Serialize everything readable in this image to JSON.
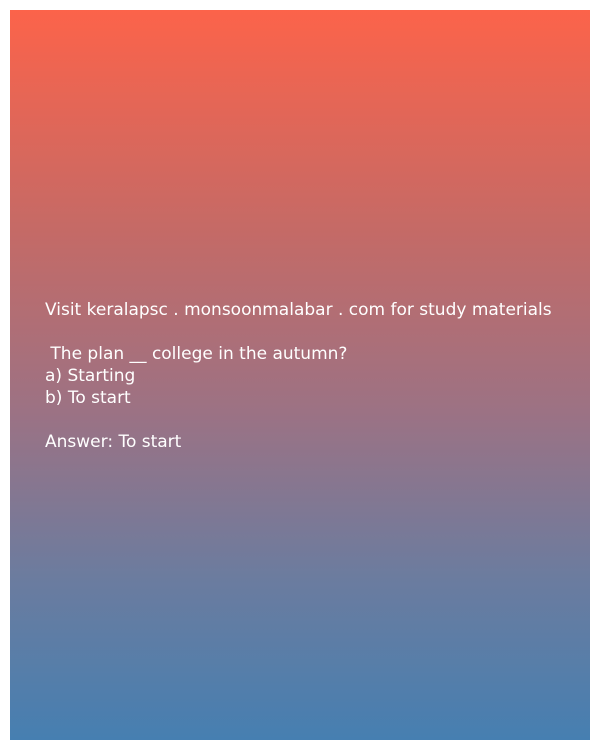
{
  "header": {
    "visit_text": "Visit keralapsc . monsoonmalabar . com for study materials"
  },
  "question": {
    "prompt": " The plan __ college in the autumn?",
    "options": [
      "a) Starting",
      "b) To start"
    ]
  },
  "answer": {
    "text": "Answer: To start"
  },
  "colors": {
    "gradient_top": "#fc634a",
    "gradient_bottom": "#467fb1",
    "text": "#ffffff"
  }
}
